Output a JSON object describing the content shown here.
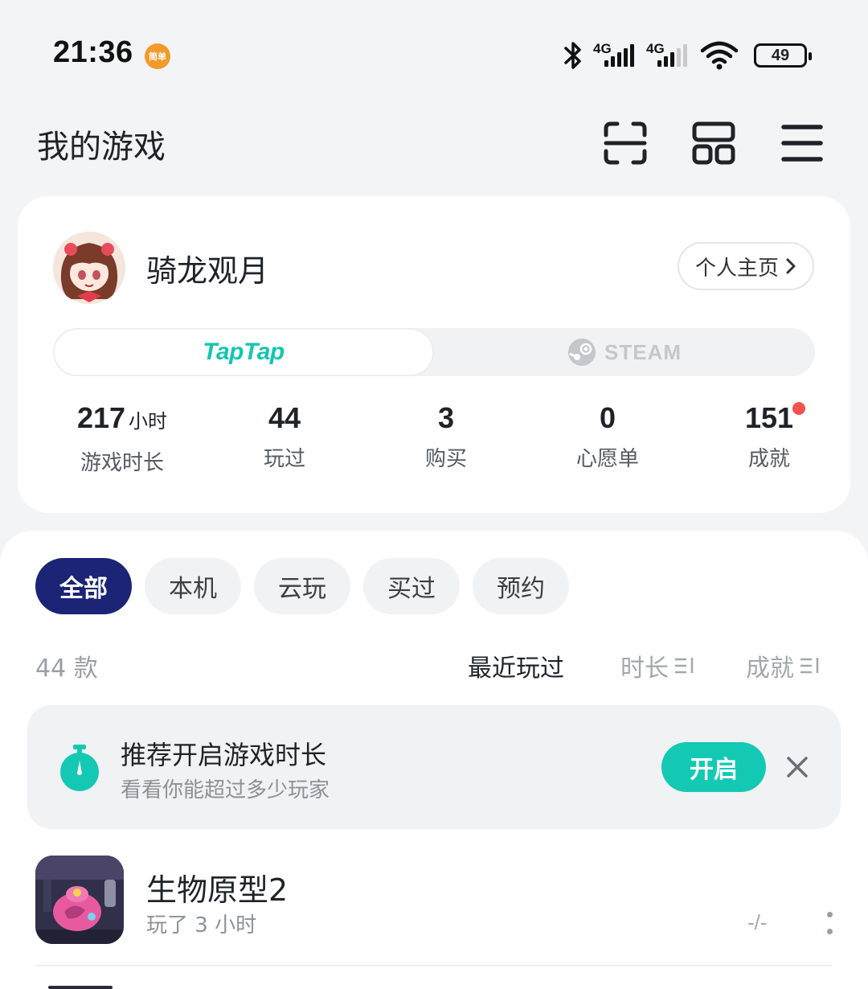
{
  "status_bar": {
    "time": "21:36",
    "notification_badge": "简单",
    "network_1": "4G",
    "network_2": "4G",
    "battery": "49"
  },
  "header": {
    "title": "我的游戏",
    "icons": [
      "scan-icon",
      "layout-grid-icon",
      "menu-icon"
    ]
  },
  "profile": {
    "username": "骑龙观月",
    "homepage_label": "个人主页",
    "platforms": {
      "active": "TapTap",
      "inactive": "STEAM"
    },
    "stats": [
      {
        "value": "217",
        "unit": "小时",
        "label": "游戏时长"
      },
      {
        "value": "44",
        "unit": "",
        "label": "玩过"
      },
      {
        "value": "3",
        "unit": "",
        "label": "购买"
      },
      {
        "value": "0",
        "unit": "",
        "label": "心愿单"
      },
      {
        "value": "151",
        "unit": "",
        "label": "成就",
        "has_dot": true
      }
    ]
  },
  "filters": [
    "全部",
    "本机",
    "云玩",
    "买过",
    "预约"
  ],
  "list": {
    "count": "44 款",
    "sort": [
      {
        "label": "最近玩过",
        "active": true
      },
      {
        "label": "时长",
        "active": false
      },
      {
        "label": "成就",
        "active": false
      }
    ]
  },
  "banner": {
    "title": "推荐开启游戏时长",
    "subtitle": "看看你能超过多少玩家",
    "button": "开启"
  },
  "games": [
    {
      "title": "生物原型2",
      "playtime": "玩了 3 小时",
      "achievements": "-/-"
    }
  ],
  "colors": {
    "accent_teal": "#14c9b3",
    "active_chip": "#1b2475",
    "notification_dot": "#f3524f"
  }
}
